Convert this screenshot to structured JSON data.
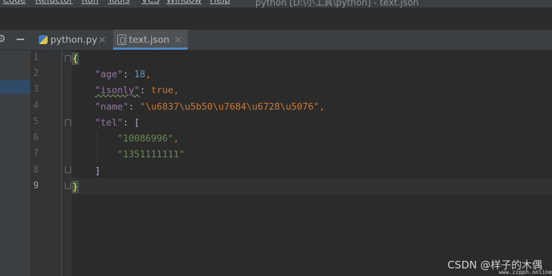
{
  "menubar": {
    "items": [
      "Code",
      "Refactor",
      "Run",
      "Tools",
      "VCS",
      "Window",
      "Help"
    ],
    "title": "python [D:\\小工具\\python] - text.json"
  },
  "tabs": [
    {
      "label": "python.py",
      "icon": "python-file-icon",
      "active": false
    },
    {
      "label": "text.json",
      "icon": "json-file-icon",
      "active": true
    }
  ],
  "editor": {
    "line_numbers": [
      "1",
      "2",
      "3",
      "4",
      "5",
      "6",
      "7",
      "8",
      "9"
    ],
    "current_line": 9,
    "lines": [
      {
        "open": "{"
      },
      {
        "key": "\"age\"",
        "colon": ": ",
        "num": "18",
        "comma": ","
      },
      {
        "key": "\"isonly\"",
        "colon": ": ",
        "kw": "true",
        "comma": ","
      },
      {
        "key": "\"name\"",
        "colon": ": ",
        "str": "\"\\u6837\\u5b50\\u7684\\u6728\\u5076\"",
        "comma": ","
      },
      {
        "key": "\"tel\"",
        "colon": ": ",
        "bracket": "["
      },
      {
        "str": "\"10086996\"",
        "comma": ","
      },
      {
        "str": "\"1351111111\""
      },
      {
        "bracket": "]"
      },
      {
        "close": "}"
      }
    ]
  },
  "watermark": {
    "text": "CSDN @样子的木偶",
    "small": "www.zzpph.online"
  },
  "colors": {
    "key": "#9876aa",
    "number": "#6897bb",
    "keyword": "#cc7832",
    "string": "#6a8759",
    "active_tab_underline": "#4a88c7"
  }
}
